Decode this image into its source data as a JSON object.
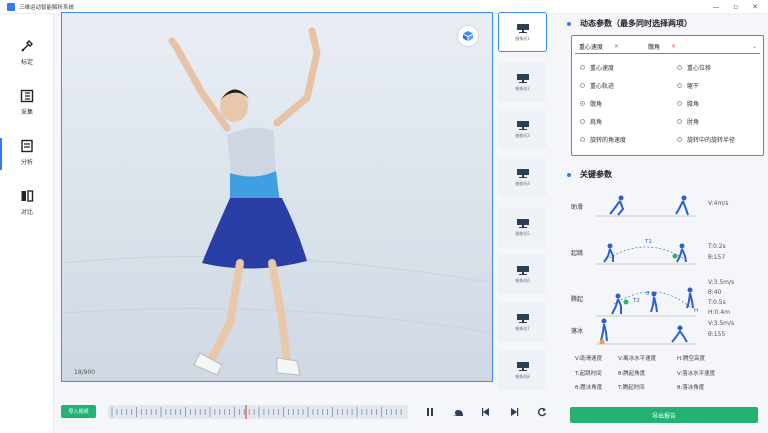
{
  "window": {
    "title": "三维运动智能解析系统",
    "controls": [
      "—",
      "▫",
      "✕"
    ]
  },
  "nav": {
    "items": [
      {
        "label": "标定",
        "icon": "calibrate-icon",
        "active": false
      },
      {
        "label": "采集",
        "icon": "capture-icon",
        "active": false
      },
      {
        "label": "分析",
        "icon": "analysis-icon",
        "active": true
      },
      {
        "label": "对比",
        "icon": "compare-icon",
        "active": false
      }
    ]
  },
  "video": {
    "frame_counter": "18/900",
    "model_button_icon": "3d-model-icon"
  },
  "thumbnails": [
    {
      "label": "摄像机1",
      "selected": true
    },
    {
      "label": "摄像机2",
      "selected": false
    },
    {
      "label": "摄像机3",
      "selected": false
    },
    {
      "label": "摄像机4",
      "selected": false
    },
    {
      "label": "摄像机5",
      "selected": false
    },
    {
      "label": "摄像机6",
      "selected": false
    },
    {
      "label": "摄像机7",
      "selected": false
    },
    {
      "label": "摄像机8",
      "selected": false
    }
  ],
  "timeline": {
    "import_label": "导入视频"
  },
  "dynamic": {
    "title": "动态参数（最多同时选择两项）",
    "selected_tags": [
      "重心速度",
      "髋角"
    ],
    "options": [
      {
        "label": "重心速度",
        "checked": false
      },
      {
        "label": "重心位移",
        "checked": false
      },
      {
        "label": "重心轨迹",
        "checked": false
      },
      {
        "label": "躯干",
        "checked": false
      },
      {
        "label": "髋角",
        "checked": true
      },
      {
        "label": "膝角",
        "checked": false
      },
      {
        "label": "肩角",
        "checked": false
      },
      {
        "label": "肘角",
        "checked": false
      },
      {
        "label": "旋转的角速度",
        "checked": false
      },
      {
        "label": "旋转中的旋转半径",
        "checked": false
      }
    ]
  },
  "key_params": {
    "title": "关键参数",
    "rows": [
      {
        "label": "助滑",
        "values": [
          "V:4m/s"
        ]
      },
      {
        "label": "起跳",
        "values": [
          "T:0.2s",
          "θ:157"
        ],
        "diagram": [
          "T1"
        ]
      },
      {
        "label": "腾起",
        "values": [
          "V:3.5m/s",
          "θ:40",
          "T:0.5s",
          "H:0.4m"
        ],
        "diagram": [
          "T2",
          "θ",
          "H"
        ]
      },
      {
        "label": "落冰",
        "values": [
          "V:3.5m/s",
          "θ:155"
        ]
      }
    ],
    "legend": [
      "V:助滑速度",
      "V:离冰水平速度",
      "H:腾空高度",
      "T:起跳时间",
      "θ:腾起角度",
      "V:落冰水平速度",
      "θ:蹬冰角度",
      "T:腾起时间",
      "θ:落冰角度"
    ]
  },
  "report_button": "导出报告"
}
